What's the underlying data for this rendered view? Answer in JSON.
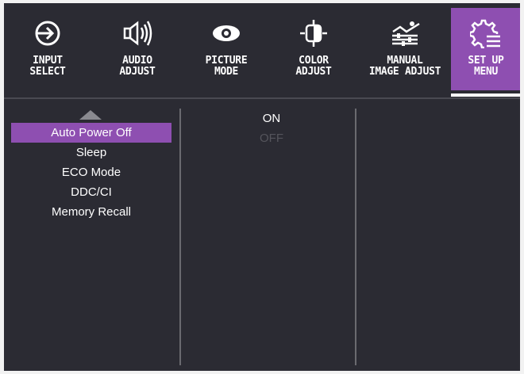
{
  "tabs": [
    {
      "label": "Input\nSelect",
      "icon": "input-icon"
    },
    {
      "label": "Audio\nAdjust",
      "icon": "speaker-icon"
    },
    {
      "label": "Picture\nMode",
      "icon": "eye-icon"
    },
    {
      "label": "Color\nAdjust",
      "icon": "color-icon"
    },
    {
      "label": "Manual\nImage Adjust",
      "icon": "image-adjust-icon"
    },
    {
      "label": "Set Up\nMenu",
      "icon": "gear-menu-icon",
      "active": true
    }
  ],
  "menu": {
    "items": [
      "Auto Power Off",
      "Sleep",
      "ECO Mode",
      "DDC/CI",
      "Memory Recall"
    ],
    "selected": "Auto Power Off"
  },
  "options": {
    "items": [
      "ON",
      "OFF"
    ]
  },
  "colors": {
    "background": "#2b2b33",
    "accent": "#8e4fb1",
    "text": "#ffffff",
    "disabled_text": "#55555c"
  }
}
